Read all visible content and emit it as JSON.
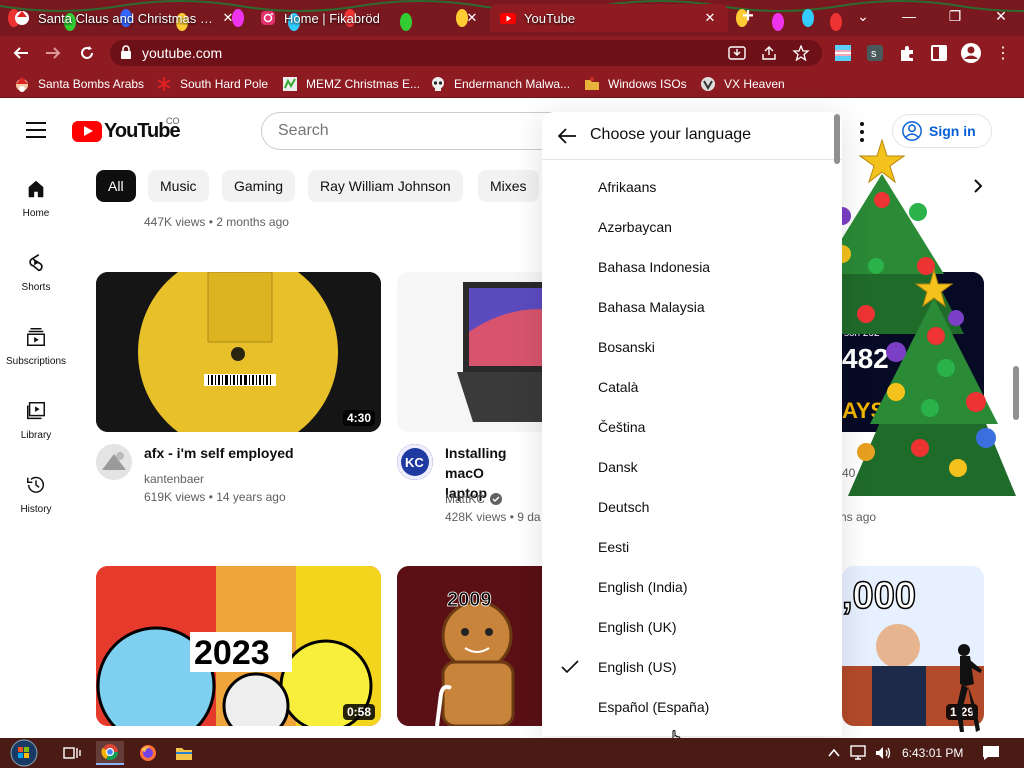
{
  "browser": {
    "tabs": [
      {
        "label": "Santa Claus and Christmas at the",
        "favicon": "santa-favicon"
      },
      {
        "label": "Home | Fikabröd",
        "favicon": "instagram-icon"
      },
      {
        "label": "YouTube",
        "favicon": "youtube-icon"
      }
    ],
    "url": "youtube.com",
    "bookmarks": [
      {
        "label": "Santa Bombs Arabs",
        "icon": "santa-icon"
      },
      {
        "label": "South Hard Pole",
        "icon": "snowflake-icon"
      },
      {
        "label": "MEMZ Christmas E...",
        "icon": "memz-icon"
      },
      {
        "label": "Endermanch Malwa...",
        "icon": "skull-icon"
      },
      {
        "label": "Windows ISOs",
        "icon": "folder-icon"
      },
      {
        "label": "VX Heaven",
        "icon": "vx-icon"
      }
    ]
  },
  "youtube": {
    "logo_text": "YouTube",
    "country_code": "CO",
    "search_placeholder": "Search",
    "signin_label": "Sign in",
    "sidebar": [
      {
        "label": "Home",
        "icon": "home-icon"
      },
      {
        "label": "Shorts",
        "icon": "shorts-icon"
      },
      {
        "label": "Subscriptions",
        "icon": "subscriptions-icon"
      },
      {
        "label": "Library",
        "icon": "library-icon"
      },
      {
        "label": "History",
        "icon": "history-icon"
      }
    ],
    "chips": [
      "All",
      "Music",
      "Gaming",
      "Ray William Johnson",
      "Mixes"
    ],
    "top_row_meta": "447K views • 2 months ago",
    "videos": [
      {
        "title": "afx - i'm self employed",
        "channel": "kantenbaer",
        "stats": "619K views • 14 years ago",
        "duration": "4:30"
      },
      {
        "title": "Installing macO",
        "title_line2": "laptop",
        "channel": "MattKC",
        "stats": "428K views • 9 da",
        "verified": true
      },
      {
        "stats_partial": "40",
        "ago_partial": "nths ago"
      },
      {
        "duration": "0:58",
        "overlay_text": "2023"
      },
      {
        "overlay_text": "2009"
      },
      {
        "duration": "1:29",
        "overlay_text": ",000"
      }
    ]
  },
  "language_menu": {
    "title": "Choose your language",
    "items": [
      {
        "label": "Afrikaans",
        "selected": false
      },
      {
        "label": "Azərbaycan",
        "selected": false
      },
      {
        "label": "Bahasa Indonesia",
        "selected": false
      },
      {
        "label": "Bahasa Malaysia",
        "selected": false
      },
      {
        "label": "Bosanski",
        "selected": false
      },
      {
        "label": "Català",
        "selected": false
      },
      {
        "label": "Čeština",
        "selected": false
      },
      {
        "label": "Dansk",
        "selected": false
      },
      {
        "label": "Deutsch",
        "selected": false
      },
      {
        "label": "Eesti",
        "selected": false
      },
      {
        "label": "English (India)",
        "selected": false
      },
      {
        "label": "English (UK)",
        "selected": false
      },
      {
        "label": "English (US)",
        "selected": true
      },
      {
        "label": "Español (España)",
        "selected": false
      }
    ]
  },
  "taskbar": {
    "clock": "6:43:01 PM",
    "apps": [
      "start-orb-icon",
      "task-view-icon",
      "chrome-icon",
      "firefox-icon",
      "file-explorer-icon"
    ]
  },
  "colors": {
    "chrome_frame": "#8e1b22",
    "youtube_red": "#ff0000",
    "signin_blue": "#065fd4",
    "taskbar": "#4a1a14"
  }
}
